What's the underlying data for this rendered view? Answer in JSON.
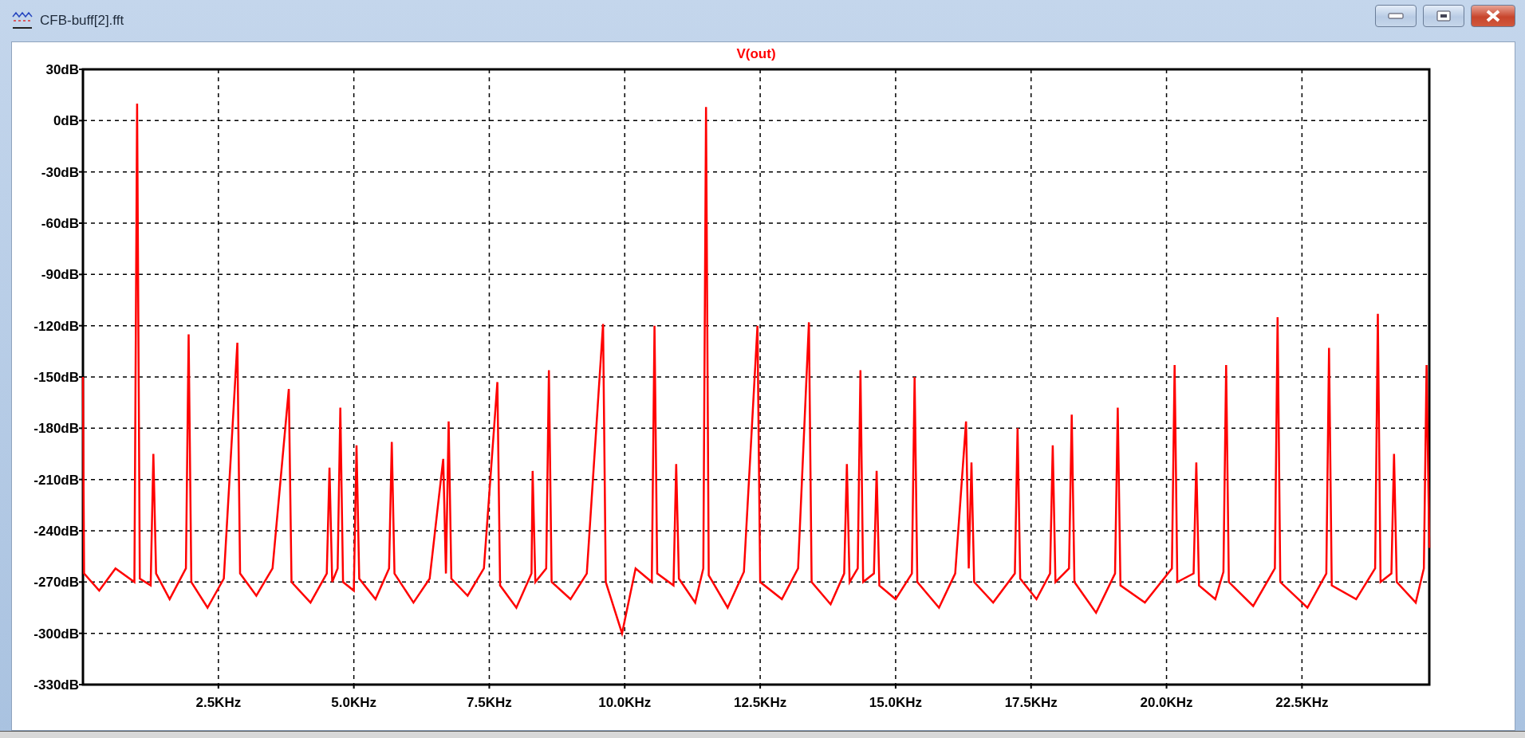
{
  "window": {
    "title": "CFB-buff[2].fft"
  },
  "plot": {
    "chart_data": {
      "type": "line",
      "grid": true,
      "x": [
        0,
        0.02,
        0.3,
        0.6,
        0.95,
        1.0,
        1.05,
        1.25,
        1.3,
        1.35,
        1.6,
        1.9,
        1.95,
        2.0,
        2.3,
        2.6,
        2.85,
        2.9,
        3.2,
        3.5,
        3.8,
        3.85,
        4.2,
        4.5,
        4.55,
        4.6,
        4.7,
        4.75,
        4.8,
        5.0,
        5.05,
        5.1,
        5.4,
        5.65,
        5.7,
        5.75,
        6.1,
        6.4,
        6.65,
        6.7,
        6.75,
        6.8,
        7.1,
        7.4,
        7.65,
        7.7,
        8.0,
        8.28,
        8.3,
        8.35,
        8.55,
        8.6,
        8.65,
        9.0,
        9.3,
        9.6,
        9.65,
        9.95,
        10.2,
        10.5,
        10.55,
        10.6,
        10.9,
        10.95,
        11.0,
        11.3,
        11.45,
        11.5,
        11.55,
        11.9,
        12.2,
        12.45,
        12.5,
        12.9,
        13.2,
        13.4,
        13.45,
        13.8,
        14.05,
        14.1,
        14.15,
        14.3,
        14.35,
        14.4,
        14.6,
        14.65,
        14.7,
        15.0,
        15.3,
        15.35,
        15.4,
        15.8,
        16.1,
        16.3,
        16.35,
        16.4,
        16.45,
        16.8,
        17.2,
        17.25,
        17.3,
        17.6,
        17.85,
        17.9,
        17.95,
        18.2,
        18.25,
        18.3,
        18.7,
        19.05,
        19.1,
        19.15,
        19.6,
        20.1,
        20.15,
        20.2,
        20.5,
        20.55,
        20.6,
        20.9,
        21.05,
        21.1,
        21.15,
        21.6,
        22.0,
        22.05,
        22.1,
        22.6,
        22.95,
        23.0,
        23.05,
        23.5,
        23.85,
        23.9,
        23.95,
        24.15,
        24.2,
        24.25,
        24.6,
        24.75,
        24.8,
        24.85
      ],
      "series": [
        {
          "name": "V(out)",
          "color": "#ff0000",
          "values": [
            -150,
            -265,
            -275,
            -262,
            -270,
            10,
            -268,
            -272,
            -195,
            -265,
            -280,
            -262,
            -125,
            -270,
            -285,
            -268,
            -130,
            -265,
            -278,
            -262,
            -157,
            -270,
            -282,
            -265,
            -203,
            -270,
            -262,
            -168,
            -270,
            -275,
            -190,
            -268,
            -280,
            -262,
            -188,
            -265,
            -282,
            -268,
            -198,
            -265,
            -176,
            -268,
            -278,
            -262,
            -153,
            -272,
            -285,
            -265,
            -205,
            -270,
            -262,
            -146,
            -270,
            -280,
            -265,
            -119,
            -270,
            -300,
            -262,
            -270,
            -120,
            -265,
            -272,
            -201,
            -268,
            -282,
            -262,
            8,
            -266,
            -285,
            -264,
            -120,
            -270,
            -280,
            -262,
            -118,
            -270,
            -283,
            -265,
            -201,
            -270,
            -262,
            -146,
            -270,
            -265,
            -205,
            -272,
            -280,
            -265,
            -150,
            -270,
            -285,
            -265,
            -176,
            -262,
            -200,
            -270,
            -282,
            -265,
            -180,
            -268,
            -280,
            -265,
            -190,
            -270,
            -262,
            -172,
            -270,
            -288,
            -265,
            -168,
            -272,
            -282,
            -262,
            -143,
            -270,
            -265,
            -200,
            -272,
            -280,
            -264,
            -143,
            -270,
            -284,
            -262,
            -115,
            -270,
            -285,
            -265,
            -133,
            -272,
            -280,
            -262,
            -113,
            -270,
            -265,
            -195,
            -270,
            -282,
            -262,
            -143,
            -250
          ]
        }
      ],
      "xlim": [
        0,
        24.85
      ],
      "ylim": [
        -330,
        30
      ],
      "xticks": [
        {
          "value": 2.5,
          "label": "2.5KHz"
        },
        {
          "value": 5,
          "label": "5.0KHz"
        },
        {
          "value": 7.5,
          "label": "7.5KHz"
        },
        {
          "value": 10,
          "label": "10.0KHz"
        },
        {
          "value": 12.5,
          "label": "12.5KHz"
        },
        {
          "value": 15,
          "label": "15.0KHz"
        },
        {
          "value": 17.5,
          "label": "17.5KHz"
        },
        {
          "value": 20,
          "label": "20.0KHz"
        },
        {
          "value": 22.5,
          "label": "22.5KHz"
        }
      ],
      "yticks": [
        {
          "value": 30,
          "label": "30dB"
        },
        {
          "value": 0,
          "label": "0dB"
        },
        {
          "value": -30,
          "label": "-30dB"
        },
        {
          "value": -60,
          "label": "-60dB"
        },
        {
          "value": -90,
          "label": "-90dB"
        },
        {
          "value": -120,
          "label": "-120dB"
        },
        {
          "value": -150,
          "label": "-150dB"
        },
        {
          "value": -180,
          "label": "-180dB"
        },
        {
          "value": -210,
          "label": "-210dB"
        },
        {
          "value": -240,
          "label": "-240dB"
        },
        {
          "value": -270,
          "label": "-270dB"
        },
        {
          "value": -300,
          "label": "-300dB"
        },
        {
          "value": -330,
          "label": "-330dB"
        }
      ]
    }
  }
}
